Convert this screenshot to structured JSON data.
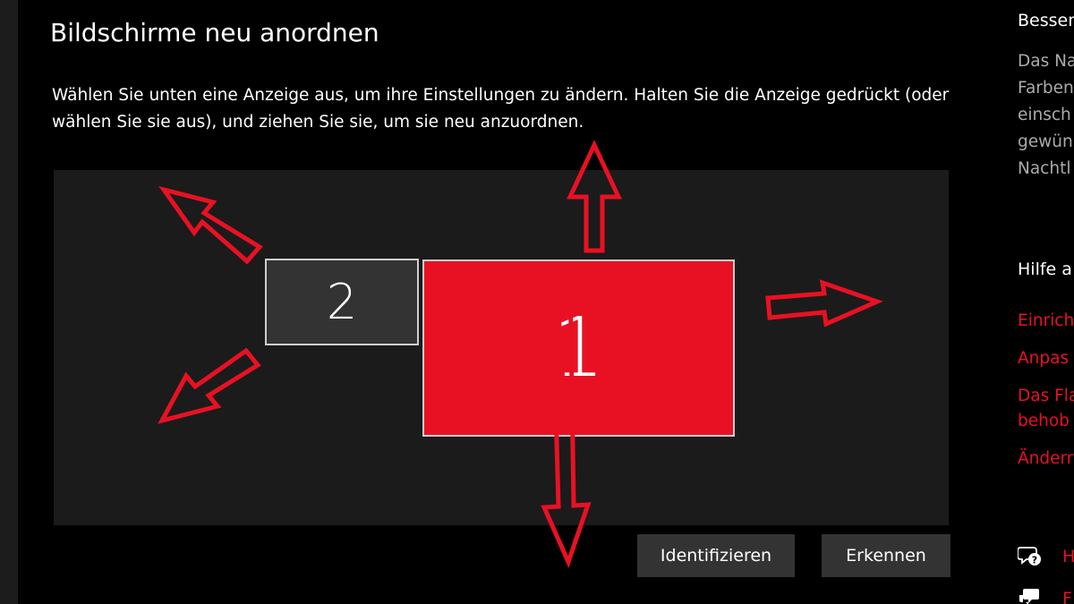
{
  "page": {
    "title": "Bildschirme neu anordnen",
    "instructions": "Wählen Sie unten eine Anzeige aus, um ihre Einstellungen zu ändern. Halten Sie die Anzeige gedrückt (oder wählen Sie sie aus), und ziehen Sie sie, um sie neu anzuordnen."
  },
  "displays": [
    {
      "number": "1",
      "selected": true,
      "color": "#e81123"
    },
    {
      "number": "2",
      "selected": false,
      "color": "#333333"
    }
  ],
  "buttons": {
    "identify_label": "Identifizieren",
    "detect_label": "Erkennen"
  },
  "right_panel": {
    "heading1": "Besser",
    "text_lines": [
      "Das Na",
      "Farben",
      "einsch",
      "gewün",
      "Nachtl"
    ],
    "heading2": "Hilfe a",
    "links": [
      {
        "lines": [
          "Einrich"
        ]
      },
      {
        "lines": [
          "Anpas"
        ]
      },
      {
        "lines": [
          "Das Fla",
          "behob"
        ]
      },
      {
        "lines": [
          "Änderr"
        ]
      }
    ],
    "help_icon_label": "H",
    "feedback_icon_label": "F",
    "help_icon": "help-chat-icon",
    "feedback_icon": "feedback-icon"
  },
  "colors": {
    "accent": "#e81123",
    "background": "#000000",
    "canvas": "#1b1b1b",
    "annotation_arrow": "#e81123"
  }
}
